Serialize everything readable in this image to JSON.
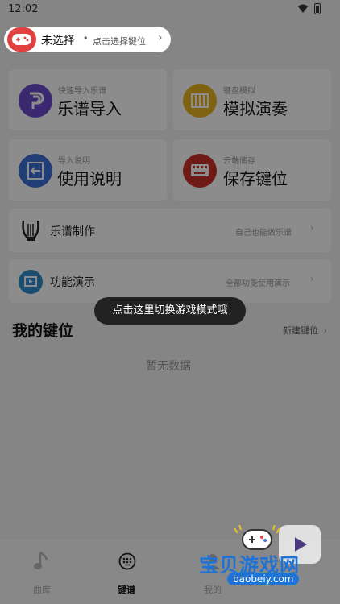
{
  "status_bar": {
    "time": "12:02"
  },
  "mode_selector": {
    "title": "未选择",
    "bullet": "•",
    "hint": "点击选择键位",
    "arrow": "›"
  },
  "feature_cards": [
    {
      "subtitle": "快速导入乐谱",
      "title": "乐谱导入",
      "icon": "score-import-icon",
      "color": "#6a4ccc"
    },
    {
      "subtitle": "键盘模拟",
      "title": "模拟演奏",
      "icon": "piano-icon",
      "color": "#e8b321"
    },
    {
      "subtitle": "导入说明",
      "title": "使用说明",
      "icon": "import-guide-icon",
      "color": "#3d6fd8"
    },
    {
      "subtitle": "云端储存",
      "title": "保存键位",
      "icon": "keyboard-icon",
      "color": "#c8322a"
    }
  ],
  "rows": [
    {
      "label": "乐谱制作",
      "hint": "自己也能做乐谱",
      "arrow": "›",
      "icon": "lyre-icon"
    },
    {
      "label": "功能演示",
      "hint": "全部功能使用演示",
      "arrow": "›",
      "icon": "video-demo-icon"
    }
  ],
  "my_keys": {
    "title": "我的键位",
    "new_label": "新建键位",
    "arrow": "›",
    "empty_text": "暂无数据"
  },
  "toast": {
    "text": "点击这里切换游戏模式哦"
  },
  "tabs": [
    {
      "label": "曲库",
      "icon": "music-note-icon",
      "active": false
    },
    {
      "label": "键谱",
      "icon": "keypad-icon",
      "active": true
    },
    {
      "label": "我的",
      "icon": "profile-icon",
      "active": false
    }
  ],
  "watermark": {
    "text": "宝贝游戏网",
    "url": "baobeiy.com"
  },
  "colors": {
    "accent_red": "#e04040",
    "overlay": "rgba(0,0,0,0.45)"
  }
}
